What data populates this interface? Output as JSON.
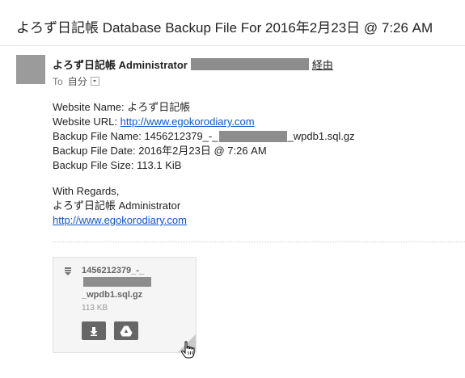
{
  "subject": "よろず日記帳 Database Backup File For 2016年2月23日 @ 7:26 AM",
  "sender": {
    "name": "よろず日記帳 Administrator",
    "via_label": "経由"
  },
  "recipient": {
    "to_label": "To",
    "to_value": "自分"
  },
  "body": {
    "site_name_label": "Website Name: ",
    "site_name_value": "よろず日記帳",
    "site_url_label": "Website URL: ",
    "site_url_value": "http://www.egokorodiary.com",
    "file_name_label": "Backup File Name: ",
    "file_name_prefix": "1456212379_-_",
    "file_name_suffix": "_wpdb1.sql.gz",
    "file_date_label": "Backup File Date: ",
    "file_date_value": "2016年2月23日 @ 7:26 AM",
    "file_size_label": "Backup File Size: ",
    "file_size_value": "113.1 KiB",
    "regards": "With Regards,",
    "signature": "よろず日記帳 Administrator",
    "signature_url": "http://www.egokorodiary.com"
  },
  "attachment": {
    "name_prefix": "1456212379_-_",
    "name_suffix": "_wpdb1.sql.gz",
    "size": "113 KB"
  },
  "icons": {
    "avatar": "avatar-placeholder",
    "dropdown": "chevron-down-icon",
    "file": "zip-file-icon",
    "download": "download-icon",
    "drive": "google-drive-icon",
    "cursor": "hand-pointer-icon"
  },
  "colors": {
    "link": "#1155cc",
    "redaction": "#8d8d8d",
    "avatar": "#9b9b9b",
    "button": "#666666"
  }
}
